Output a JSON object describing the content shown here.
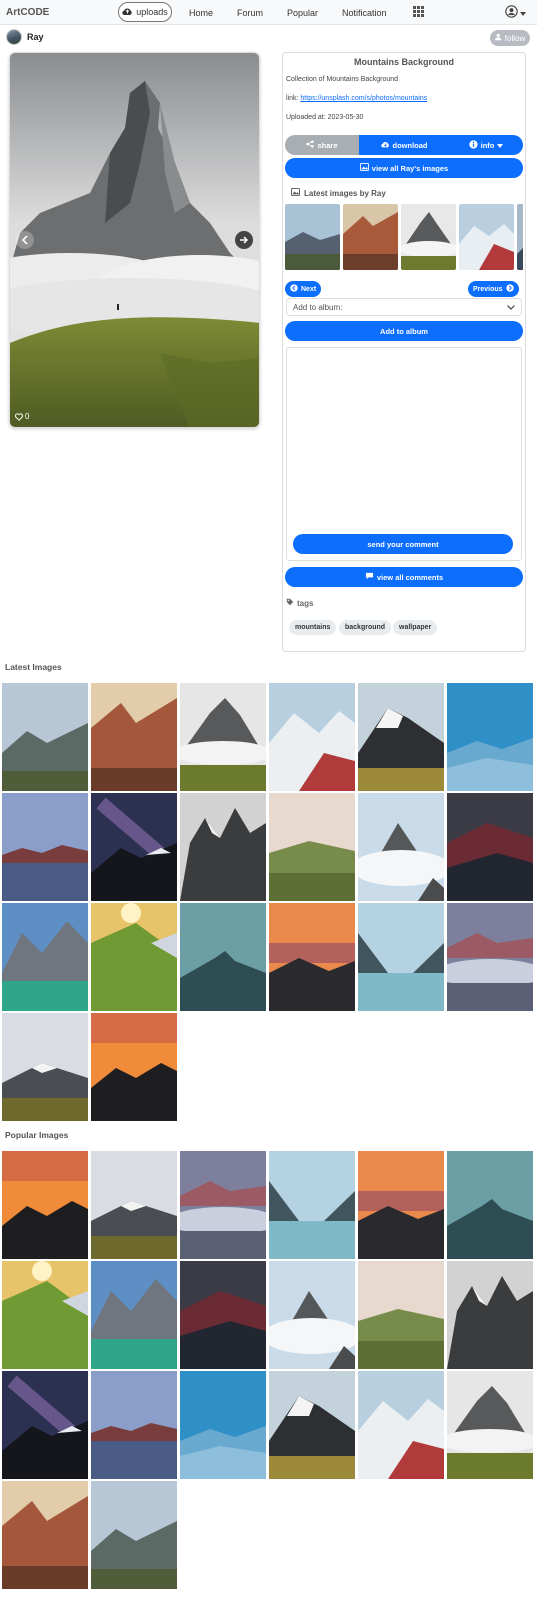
{
  "nav": {
    "brand": "ArtCODE",
    "uploads": "uploads",
    "links": [
      "Home",
      "Forum",
      "Popular",
      "Notification"
    ],
    "icons": {
      "uploads": "cloud-upload-icon",
      "apps": "grid-icon",
      "user": "user-circle-icon"
    }
  },
  "owner": {
    "name": "Ray",
    "follow": "follow"
  },
  "image": {
    "likes": "0"
  },
  "panel": {
    "title": "Mountains Background",
    "description": "Collection of Mountains Background",
    "link_label": "link:",
    "link_url": "https://unsplash.com/s/photos/mountains",
    "uploaded_label": "Uploaded at: 2023-05-30",
    "share": "share",
    "download": "download",
    "info": "info",
    "view_all_images": "view all Ray's images",
    "latest_by": "Latest images by Ray",
    "next": "Next",
    "previous": "Previous",
    "album_placeholder": "Add to album:",
    "add_to_album": "Add to album",
    "send_comment": "send your comment",
    "view_all_comments": "view all comments",
    "tags_label": "tags",
    "tags": [
      "mountains",
      "background",
      "wallpaper"
    ]
  },
  "sections": {
    "latest": "Latest Images",
    "popular": "Popular Images"
  }
}
